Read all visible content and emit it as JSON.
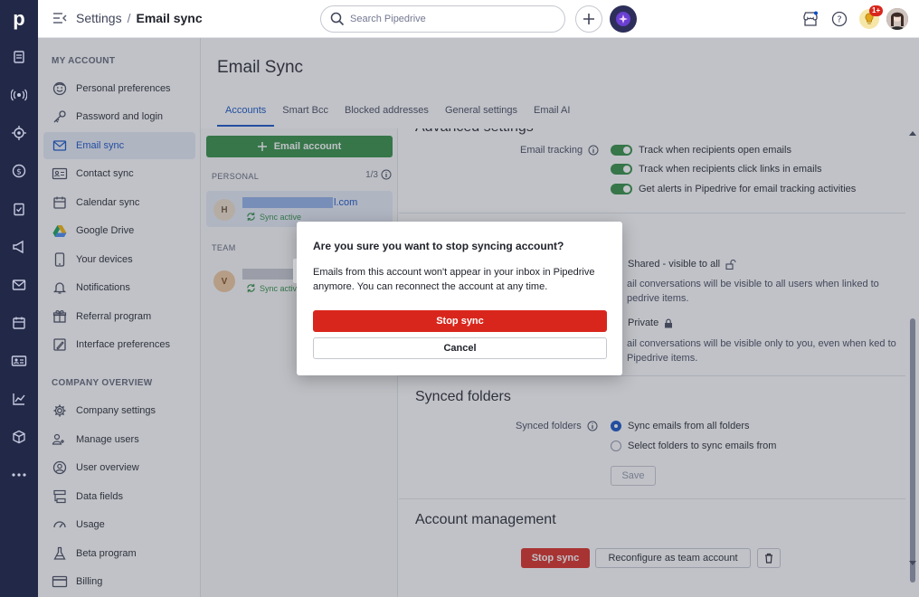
{
  "topbar": {
    "breadcrumb_root": "Settings",
    "breadcrumb_sep": "/",
    "breadcrumb_current": "Email sync",
    "search_placeholder": "Search Pipedrive",
    "notification_badge": "1+"
  },
  "rail": {
    "logo": "p"
  },
  "sidebar": {
    "my_account_header": "MY ACCOUNT",
    "my_account_items": [
      {
        "label": "Personal preferences",
        "icon": "smiley-icon"
      },
      {
        "label": "Password and login",
        "icon": "key-icon"
      },
      {
        "label": "Email sync",
        "icon": "envelope-icon"
      },
      {
        "label": "Contact sync",
        "icon": "contact-card-icon"
      },
      {
        "label": "Calendar sync",
        "icon": "calendar-icon"
      },
      {
        "label": "Google Drive",
        "icon": "google-drive-icon"
      },
      {
        "label": "Your devices",
        "icon": "phone-icon"
      },
      {
        "label": "Notifications",
        "icon": "bell-icon"
      },
      {
        "label": "Referral program",
        "icon": "gift-icon"
      },
      {
        "label": "Interface preferences",
        "icon": "brush-icon"
      }
    ],
    "company_header": "COMPANY OVERVIEW",
    "company_items": [
      {
        "label": "Company settings",
        "icon": "gear-icon"
      },
      {
        "label": "Manage users",
        "icon": "users-icon"
      },
      {
        "label": "User overview",
        "icon": "user-circle-icon"
      },
      {
        "label": "Data fields",
        "icon": "data-fields-icon"
      },
      {
        "label": "Usage",
        "icon": "gauge-icon"
      },
      {
        "label": "Beta program",
        "icon": "flask-icon"
      },
      {
        "label": "Billing",
        "icon": "credit-card-icon"
      }
    ]
  },
  "main": {
    "title": "Email Sync",
    "tabs": [
      "Accounts",
      "Smart Bcc",
      "Blocked addresses",
      "General settings",
      "Email AI"
    ],
    "add_account_label": "Email account",
    "personal_label": "PERSONAL",
    "personal_count": "1/3",
    "team_label": "TEAM",
    "accounts": [
      {
        "initial": "H",
        "email_suffix": "l.com",
        "status": "Sync active"
      },
      {
        "initial": "V",
        "email_suffix": "",
        "status": "Sync active"
      }
    ]
  },
  "detail": {
    "advanced_title": "Advanced settings",
    "tracking_label": "Email tracking",
    "tracking_options": [
      "Track when recipients open emails",
      "Track when recipients click links in emails",
      "Get alerts in Pipedrive for email tracking activities"
    ],
    "shared_label": "Shared - visible to all",
    "shared_desc": "ail conversations will be visible to all users when linked to pedrive items.",
    "private_label": "Private",
    "private_desc": "ail conversations will be visible only to you, even when ked to Pipedrive items.",
    "synced_folders_title": "Synced folders",
    "synced_folders_label": "Synced folders",
    "folder_options": [
      "Sync emails from all folders",
      "Select folders to sync emails from"
    ],
    "save_label": "Save",
    "account_mgmt_title": "Account management",
    "stop_sync_label": "Stop sync",
    "reconfigure_label": "Reconfigure as team account"
  },
  "modal": {
    "title": "Are you sure you want to stop syncing account?",
    "body": "Emails from this account won't appear in your inbox in Pipedrive anymore. You can reconnect the account at any time.",
    "confirm_label": "Stop sync",
    "cancel_label": "Cancel"
  },
  "colors": {
    "rail": "#222948",
    "accent": "#0d4dc4",
    "success": "#2b8a3e",
    "danger": "#d9261c"
  }
}
